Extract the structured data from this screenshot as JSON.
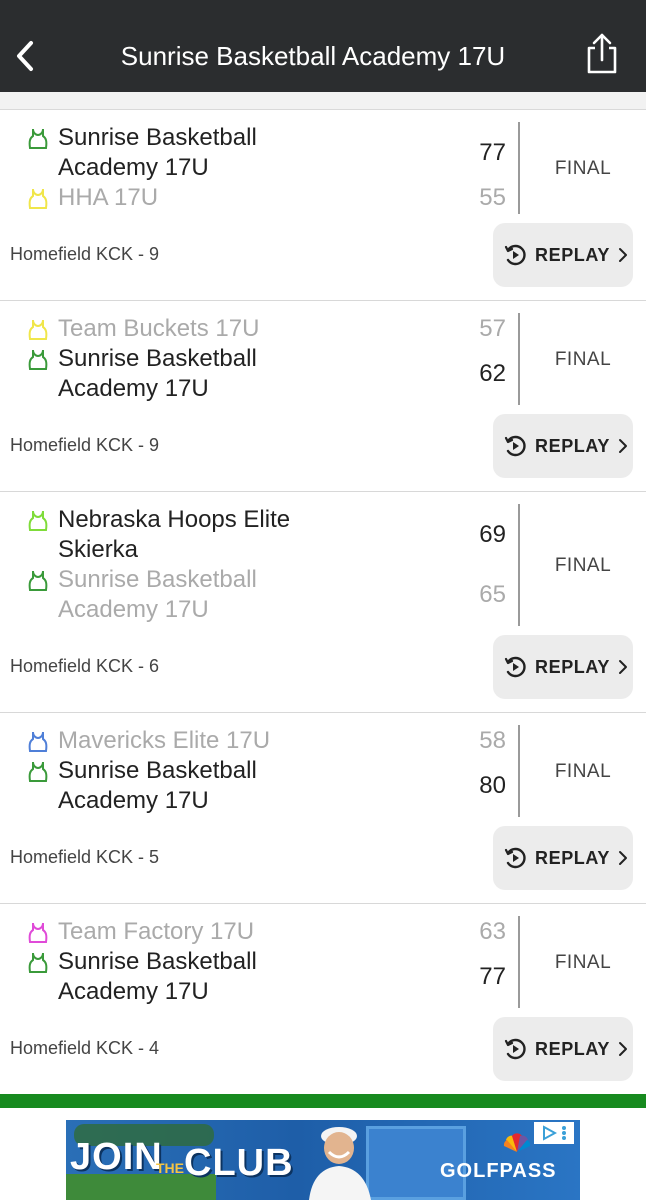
{
  "header": {
    "title": "Sunrise Basketball Academy 17U"
  },
  "colors": {
    "header_bg": "#2b2d2f",
    "accent_green": "#178a1f",
    "jersey_sunrise": "#3a9a3a",
    "jersey_yellow": "#f0e64a",
    "jersey_lime": "#7fdc3a",
    "jersey_blue": "#4f7fd8",
    "jersey_magenta": "#e04ad8"
  },
  "games": [
    {
      "team1": {
        "name": "Sunrise Basketball Academy 17U",
        "score": "77",
        "jersey": "jersey-green-icon"
      },
      "team2": {
        "name": "HHA 17U",
        "score": "55",
        "jersey": "jersey-yellow-icon"
      },
      "status": "FINAL",
      "location": "Homefield KCK - 9",
      "replay_label": "REPLAY"
    },
    {
      "team1": {
        "name": "Team Buckets 17U",
        "score": "57",
        "jersey": "jersey-yellow-icon"
      },
      "team2": {
        "name": "Sunrise Basketball Academy 17U",
        "score": "62",
        "jersey": "jersey-green-icon"
      },
      "status": "FINAL",
      "location": "Homefield KCK - 9",
      "replay_label": "REPLAY"
    },
    {
      "team1": {
        "name": "Nebraska Hoops Elite Skierka",
        "score": "69",
        "jersey": "jersey-lime-icon"
      },
      "team2": {
        "name": "Sunrise Basketball Academy 17U",
        "score": "65",
        "jersey": "jersey-green-icon"
      },
      "status": "FINAL",
      "location": "Homefield KCK - 6",
      "replay_label": "REPLAY"
    },
    {
      "team1": {
        "name": "Mavericks Elite 17U",
        "score": "58",
        "jersey": "jersey-blue-icon"
      },
      "team2": {
        "name": "Sunrise Basketball Academy 17U",
        "score": "80",
        "jersey": "jersey-green-icon"
      },
      "status": "FINAL",
      "location": "Homefield KCK - 5",
      "replay_label": "REPLAY"
    },
    {
      "team1": {
        "name": "Team Factory 17U",
        "score": "63",
        "jersey": "jersey-magenta-icon"
      },
      "team2": {
        "name": "Sunrise Basketball Academy 17U",
        "score": "77",
        "jersey": "jersey-green-icon"
      },
      "status": "FINAL",
      "location": "Homefield KCK - 4",
      "replay_label": "REPLAY"
    }
  ],
  "ad": {
    "join": "JOIN",
    "the": "THE",
    "club": "CLUB",
    "brand": "GOLFPASS"
  }
}
